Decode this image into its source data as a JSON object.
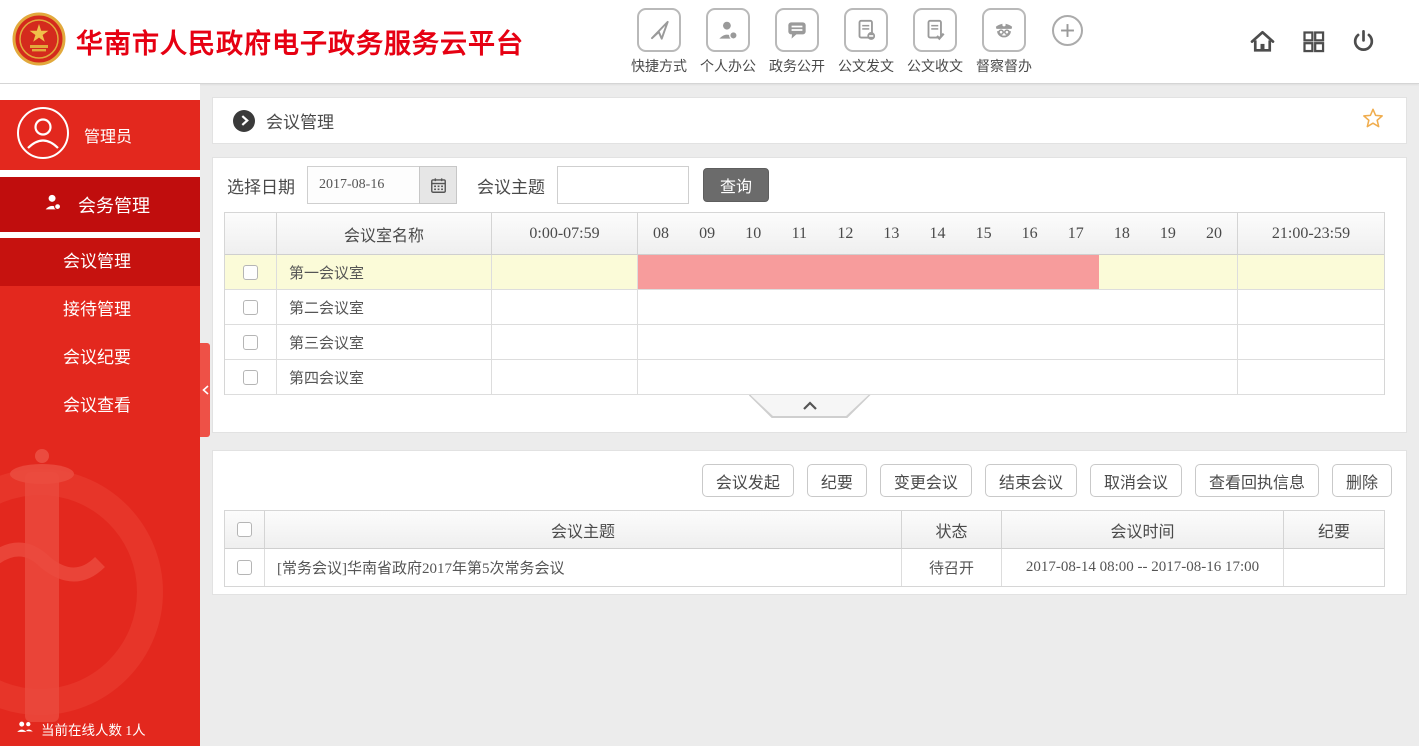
{
  "colors": {
    "brand_red": "#e60012",
    "sidebar_red": "#e3281e",
    "section_red": "#c00d0d",
    "active_red": "#c6120f",
    "busy_pink": "#f79c9c",
    "highlight_yellow": "#fbfbd8",
    "star_orange": "#f0ad4e",
    "button_dark": "#6b6b6b"
  },
  "header": {
    "title": "华南市人民政府电子政务服务云平台",
    "toolbar": [
      {
        "label": "快捷方式",
        "icon": "paper-plane-icon"
      },
      {
        "label": "个人办公",
        "icon": "person-icon"
      },
      {
        "label": "政务公开",
        "icon": "speech-bubble-icon"
      },
      {
        "label": "公文发文",
        "icon": "document-send-icon"
      },
      {
        "label": "公文收文",
        "icon": "document-check-icon"
      },
      {
        "label": "督察督办",
        "icon": "police-icon"
      }
    ]
  },
  "sidebar": {
    "user": "管理员",
    "section": "会务管理",
    "menu": [
      {
        "label": "会议管理",
        "active": true
      },
      {
        "label": "接待管理",
        "active": false
      },
      {
        "label": "会议纪要",
        "active": false
      },
      {
        "label": "会议查看",
        "active": false
      }
    ],
    "online_label": "当前在线人数 1人"
  },
  "page": {
    "title": "会议管理"
  },
  "filter": {
    "date_label": "选择日期",
    "date_value": "2017-08-16",
    "topic_label": "会议主题",
    "topic_value": "",
    "search_label": "查询"
  },
  "schedule": {
    "room_header": "会议室名称",
    "early_header": "0:00-07:59",
    "late_header": "21:00-23:59",
    "hours": [
      "08",
      "09",
      "10",
      "11",
      "12",
      "13",
      "14",
      "15",
      "16",
      "17",
      "18",
      "19",
      "20"
    ],
    "rows": [
      {
        "room": "第一会议室",
        "highlighted": true,
        "busy_from": "08:00",
        "busy_to": "17:00"
      },
      {
        "room": "第二会议室",
        "highlighted": false
      },
      {
        "room": "第三会议室",
        "highlighted": false
      },
      {
        "room": "第四会议室",
        "highlighted": false
      }
    ]
  },
  "actions": [
    "会议发起",
    "纪要",
    "变更会议",
    "结束会议",
    "取消会议",
    "查看回执信息",
    "删除"
  ],
  "meetings": {
    "headers": {
      "topic": "会议主题",
      "status": "状态",
      "time": "会议时间",
      "minutes": "纪要"
    },
    "rows": [
      {
        "topic": "[常务会议]华南省政府2017年第5次常务会议",
        "status": "待召开",
        "time": "2017-08-14 08:00 -- 2017-08-16 17:00",
        "minutes": ""
      }
    ]
  }
}
